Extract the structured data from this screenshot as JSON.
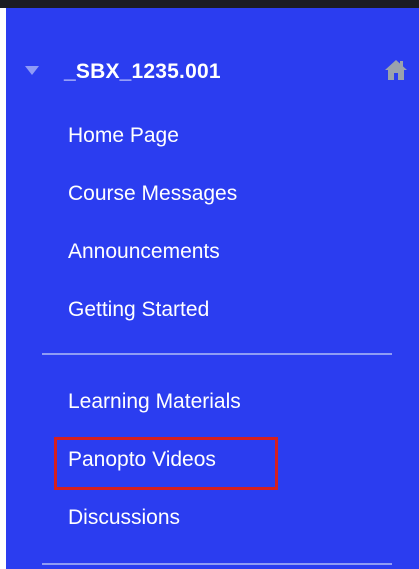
{
  "course": {
    "title": "_SBX_1235.001",
    "home_icon": "home-icon",
    "caret_icon": "caret-down-icon"
  },
  "menu": {
    "group1": [
      "Home Page",
      "Course Messages",
      "Announcements",
      "Getting Started"
    ],
    "group2": [
      "Learning Materials",
      "Panopto Videos",
      "Discussions"
    ]
  },
  "colors": {
    "panel_bg": "#2b3df0",
    "text": "#ffffff",
    "divider": "#8f9cf5",
    "highlight": "#d51f1f",
    "top_bar": "#1c1c22"
  }
}
